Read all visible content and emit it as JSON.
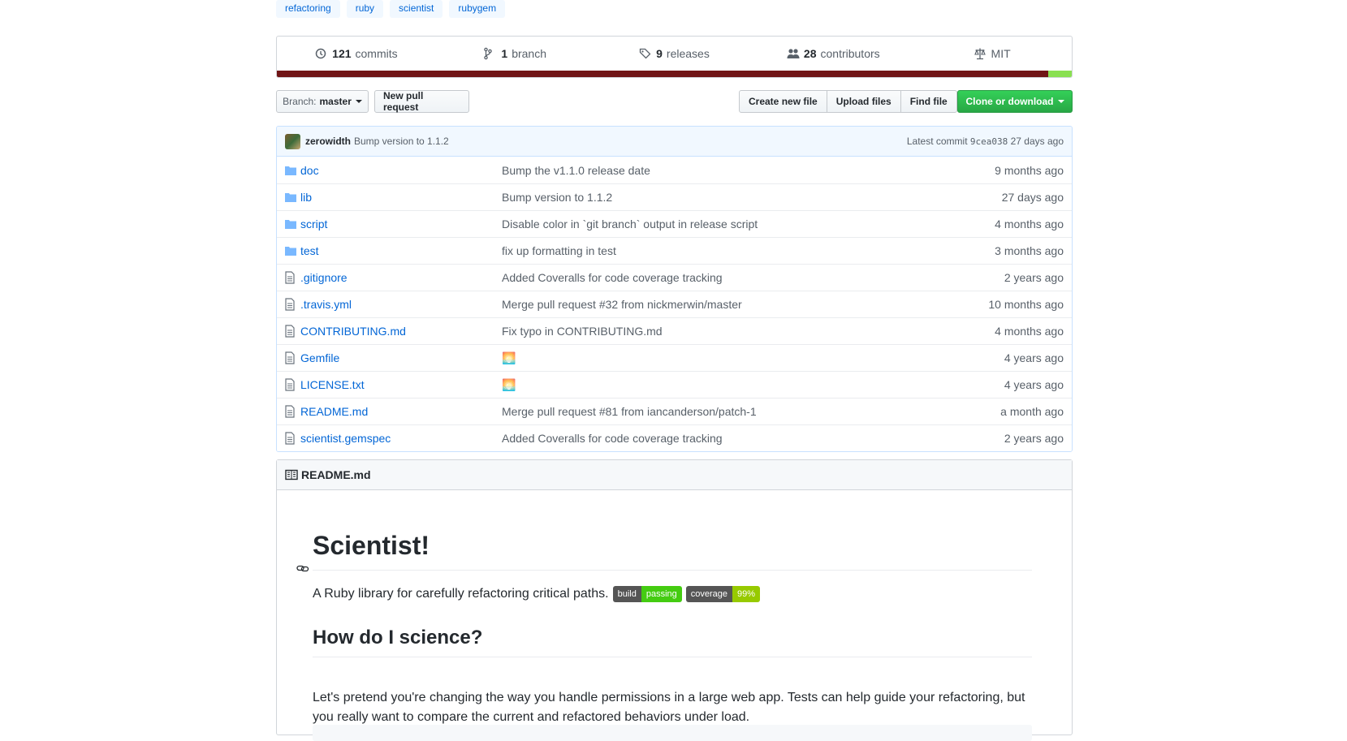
{
  "topics": [
    "refactoring",
    "ruby",
    "scientist",
    "rubygem"
  ],
  "summary": {
    "commits": {
      "count": "121",
      "label": "commits"
    },
    "branches": {
      "count": "1",
      "label": "branch"
    },
    "releases": {
      "count": "9",
      "label": "releases"
    },
    "contributors": {
      "count": "28",
      "label": "contributors"
    },
    "license": "MIT"
  },
  "language_bar": {
    "ruby_color": "#701516",
    "shell_color": "#89e051",
    "ruby_fraction": 0.97,
    "shell_fraction": 0.03
  },
  "nav": {
    "branch_prefix": "Branch:",
    "branch_name": "master",
    "new_pr": "New pull request",
    "create_file": "Create new file",
    "upload_files": "Upload files",
    "find_file": "Find file",
    "clone": "Clone or download"
  },
  "latest_commit": {
    "author": "zerowidth",
    "message": "Bump version to 1.1.2",
    "prefix": "Latest commit",
    "sha": "9cea038",
    "age": "27 days ago"
  },
  "files": [
    {
      "type": "dir",
      "name": "doc",
      "message": "Bump the v1.1.0 release date",
      "age": "9 months ago"
    },
    {
      "type": "dir",
      "name": "lib",
      "message": "Bump version to 1.1.2",
      "age": "27 days ago"
    },
    {
      "type": "dir",
      "name": "script",
      "message": "Disable color in `git branch` output in release script",
      "age": "4 months ago"
    },
    {
      "type": "dir",
      "name": "test",
      "message": "fix up formatting in test",
      "age": "3 months ago"
    },
    {
      "type": "file",
      "name": ".gitignore",
      "message": "Added Coveralls for code coverage tracking",
      "age": "2 years ago"
    },
    {
      "type": "file",
      "name": ".travis.yml",
      "message": "Merge pull request #32 from nickmerwin/master",
      "age": "10 months ago"
    },
    {
      "type": "file",
      "name": "CONTRIBUTING.md",
      "message": "Fix typo in CONTRIBUTING.md",
      "age": "4 months ago"
    },
    {
      "type": "file",
      "name": "Gemfile",
      "message": "🌅",
      "age": "4 years ago"
    },
    {
      "type": "file",
      "name": "LICENSE.txt",
      "message": "🌅",
      "age": "4 years ago"
    },
    {
      "type": "file",
      "name": "README.md",
      "message": "Merge pull request #81 from iancanderson/patch-1",
      "age": "a month ago"
    },
    {
      "type": "file",
      "name": "scientist.gemspec",
      "message": "Added Coveralls for code coverage tracking",
      "age": "2 years ago"
    }
  ],
  "readme": {
    "filename": "README.md",
    "title": "Scientist!",
    "tagline": "A Ruby library for carefully refactoring critical paths.",
    "badges": [
      {
        "label": "build",
        "value": "passing",
        "color": "#44cc11"
      },
      {
        "label": "coverage",
        "value": "99%",
        "color": "#97ca00"
      }
    ],
    "heading2": "How do I science?",
    "paragraph": "Let's pretend you're changing the way you handle permissions in a large web app. Tests can help guide your refactoring, but you really want to compare the current and refactored behaviors under load."
  }
}
